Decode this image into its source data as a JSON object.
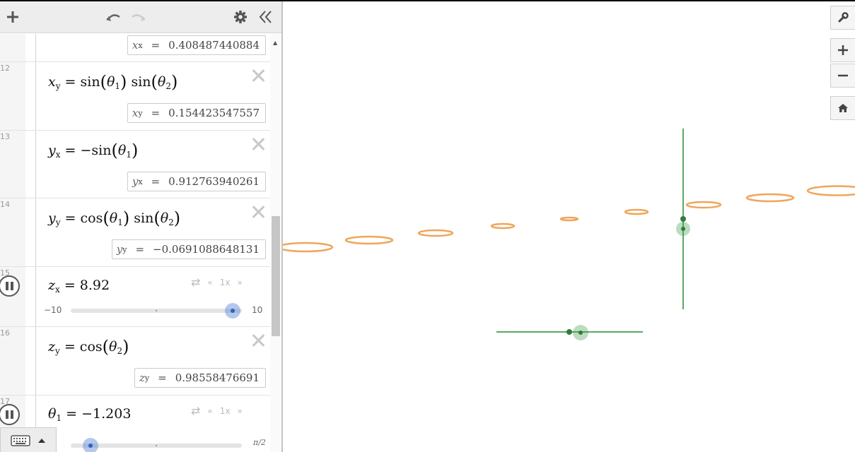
{
  "toolbar": {
    "add_icon": "plus-icon",
    "undo_icon": "undo-icon",
    "redo_icon": "redo-icon",
    "settings_icon": "gear-icon",
    "collapse_icon": "double-chevron-left-icon"
  },
  "expressions": [
    {
      "result_var": "x",
      "result_sub": "x",
      "result_value": "0.408487440884"
    },
    {
      "number": "12",
      "lhs": "x",
      "lhs_sub": "y",
      "fn1": "sin",
      "arg1": "θ",
      "arg1_sub": "1",
      "fn2": "sin",
      "arg2": "θ",
      "arg2_sub": "2",
      "result_var": "x",
      "result_sub": "y",
      "result_value": "0.154423547557"
    },
    {
      "number": "13",
      "lhs": "y",
      "lhs_sub": "x",
      "fn1": "−sin",
      "arg1": "θ",
      "arg1_sub": "1",
      "result_var": "y",
      "result_sub": "x",
      "result_value": "0.912763940261"
    },
    {
      "number": "14",
      "lhs": "y",
      "lhs_sub": "y",
      "fn1": "cos",
      "arg1": "θ",
      "arg1_sub": "1",
      "fn2": "sin",
      "arg2": "θ",
      "arg2_sub": "2",
      "result_var": "y",
      "result_sub": "y",
      "result_value": "−0.0691088648131"
    },
    {
      "number": "15",
      "lhs": "z",
      "lhs_sub": "x",
      "value": "8.92",
      "slider_min": "−10",
      "slider_max": "10",
      "slider_level": 0.946,
      "speed": "1x"
    },
    {
      "number": "16",
      "lhs": "z",
      "lhs_sub": "y",
      "fn1": "cos",
      "arg1": "θ",
      "arg1_sub": "2",
      "result_var": "z",
      "result_sub": "y",
      "result_value": "0.98558476691"
    },
    {
      "number": "17",
      "lhs": "θ",
      "lhs_sub": "1",
      "value": "−1.203",
      "slider_max": "π/2",
      "slider_level": 0.117,
      "speed": "1x"
    }
  ],
  "graph_controls": [
    "wrench-icon",
    "zoom-in-icon",
    "zoom-out-icon",
    "home-icon"
  ],
  "colors": {
    "curve": "#f0a55a",
    "axes": "#3f9a4c",
    "point": "#2f7c3a",
    "slider": "#2d63c8"
  }
}
